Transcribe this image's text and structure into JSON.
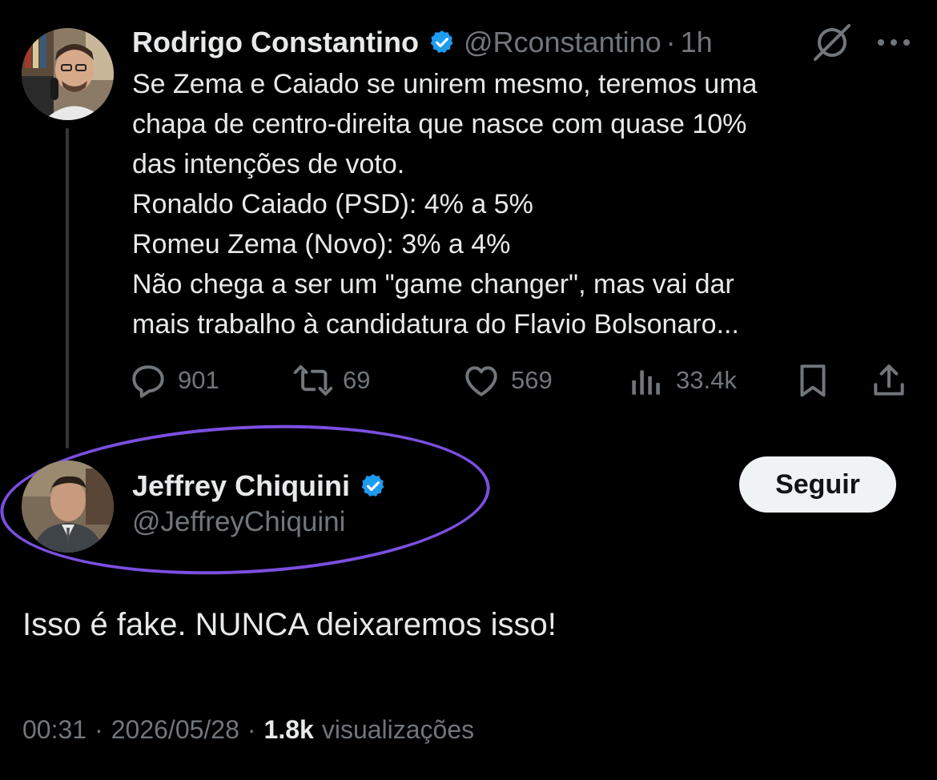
{
  "original_tweet": {
    "author_name": "Rodrigo Constantino",
    "handle": "@Rconstantino",
    "separator": "·",
    "time_ago": "1h",
    "body_lines": [
      "Se Zema e Caiado se unirem mesmo, teremos uma",
      "chapa de centro-direita que nasce com quase 10%",
      "das intenções de voto.",
      "Ronaldo Caiado (PSD): 4% a 5%",
      "Romeu Zema (Novo): 3% a 4%",
      "Não chega a ser um \"game changer\", mas vai dar",
      "mais trabalho à candidatura do Flavio Bolsonaro..."
    ],
    "stats": {
      "replies": "901",
      "reposts": "69",
      "likes": "569",
      "views": "33.4k"
    }
  },
  "reply": {
    "author_name": "Jeffrey Chiquini",
    "handle": "@JeffreyChiquini",
    "follow_label": "Seguir",
    "text": "Isso é fake. NUNCA deixaremos isso!",
    "time": "00:31",
    "date": "2026/05/28",
    "separator": "·",
    "views_count": "1.8k",
    "views_label": "visualizações"
  },
  "colors": {
    "background": "#000000",
    "primary_text": "#e7e9ea",
    "secondary_text": "#71767b",
    "verified_badge": "#1d9bf0",
    "highlight_ring": "#7b4fe0",
    "follow_button_bg": "#eff3f4"
  },
  "icons": {
    "verified": "verified-badge-icon",
    "grok": "grok-icon",
    "more": "more-options-icon",
    "reply": "reply-icon",
    "repost": "repost-icon",
    "like": "heart-icon",
    "views": "views-chart-icon",
    "bookmark": "bookmark-icon",
    "share": "share-icon"
  }
}
